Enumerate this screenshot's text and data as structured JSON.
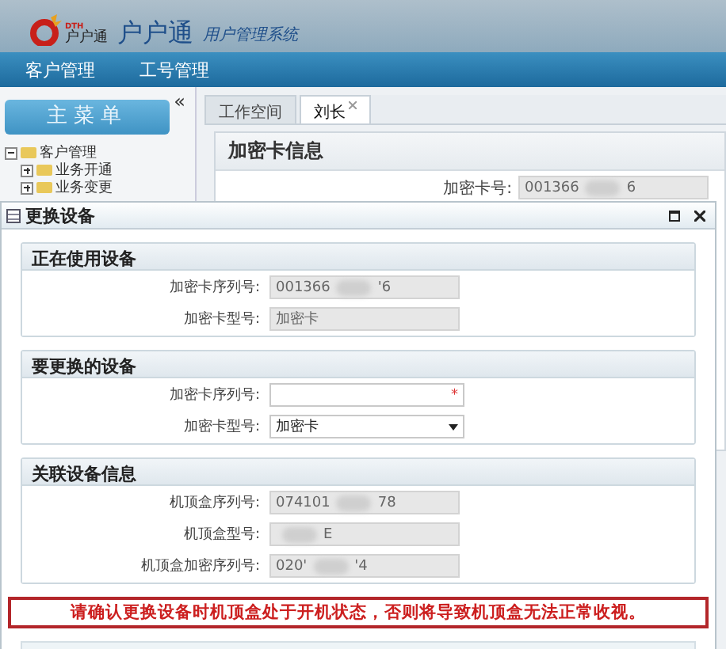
{
  "app": {
    "brand_small": "DTH",
    "brand_logo_text": "户户通",
    "title": "户户通",
    "subtitle": "用户管理系统"
  },
  "nav": [
    {
      "label": "客户管理"
    },
    {
      "label": "工号管理"
    }
  ],
  "sidebar": {
    "collapse": "«",
    "menu_button": "主菜单",
    "tree": [
      {
        "label": "客户管理",
        "expanded": true,
        "children": [
          {
            "label": "业务开通",
            "expanded": false
          },
          {
            "label": "业务变更",
            "expanded": false
          }
        ]
      }
    ]
  },
  "tabs": [
    {
      "label": "工作空间",
      "selected": false,
      "closable": false
    },
    {
      "label": "刘长",
      "selected": true,
      "closable": true
    }
  ],
  "panel": {
    "title": "加密卡信息",
    "fields": [
      {
        "label": "加密卡号:",
        "value_parts": [
          "001366",
          "6"
        ]
      }
    ]
  },
  "dialog": {
    "title": "更换设备",
    "sections": [
      {
        "title": "正在使用设备",
        "fields": [
          {
            "label": "加密卡序列号:",
            "kind": "readonly",
            "value_parts": [
              "001366",
              "'6"
            ]
          },
          {
            "label": "加密卡型号:",
            "kind": "readonly",
            "value_parts": [
              "加密卡"
            ]
          }
        ]
      },
      {
        "title": "要更换的设备",
        "fields": [
          {
            "label": "加密卡序列号:",
            "kind": "input",
            "required": "*"
          },
          {
            "label": "加密卡型号:",
            "kind": "select",
            "value": "加密卡"
          }
        ]
      },
      {
        "title": "关联设备信息",
        "fields": [
          {
            "label": "机顶盒序列号:",
            "kind": "readonly",
            "value_parts": [
              "074101",
              "78"
            ]
          },
          {
            "label": "机顶盒型号:",
            "kind": "readonly",
            "lead_blur": true,
            "value_parts": [
              "E"
            ]
          },
          {
            "label": "机顶盒加密序列号:",
            "kind": "readonly",
            "value_parts": [
              "020'",
              "'4"
            ]
          }
        ]
      }
    ],
    "warning": "请确认更换设备时机顶盒处于开机状态，否则将导致机顶盒无法正常收视。"
  }
}
